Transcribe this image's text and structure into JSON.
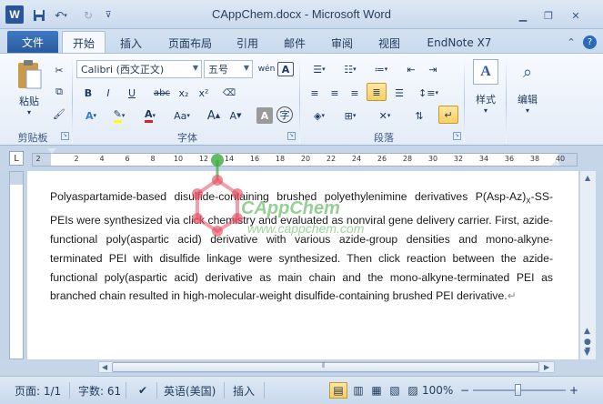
{
  "titlebar": {
    "app_logo": "W",
    "title": "CAppChem.docx - Microsoft Word",
    "save_icon": "save-icon",
    "undo_icon": "undo-icon",
    "redo_icon": "redo-icon",
    "customize_icon": "qat-dropdown-icon"
  },
  "tabs": {
    "file": "文件",
    "items": [
      "开始",
      "插入",
      "页面布局",
      "引用",
      "邮件",
      "审阅",
      "视图",
      "EndNote X7"
    ],
    "active": "开始"
  },
  "ribbon": {
    "clipboard": {
      "label": "剪贴板",
      "paste": "粘贴"
    },
    "font": {
      "label": "字体",
      "font_name": "Calibri (西文正文)",
      "font_size": "五号",
      "bold": "B",
      "italic": "I",
      "underline": "U",
      "strike": "abc",
      "subscript": "x₂",
      "superscript": "x²",
      "grow": "A",
      "shrink": "A",
      "case": "Aa",
      "char_border": "A",
      "char_shade": "A",
      "phonetic": "wén",
      "enclose": "字"
    },
    "paragraph": {
      "label": "段落"
    },
    "styles": {
      "label": "样式"
    },
    "editing": {
      "label": "编辑"
    }
  },
  "ruler": {
    "labels": [
      "2",
      "2",
      "4",
      "6",
      "8",
      "10",
      "12",
      "14",
      "16",
      "18",
      "20",
      "22",
      "24",
      "26",
      "28",
      "30",
      "32",
      "34",
      "36",
      "38",
      "40"
    ],
    "corner": "L"
  },
  "document": {
    "line1": "Polyaspartamide-based disulfide-containing brushed polyethylenimine derivatives",
    "line2a": "P(Asp-Az)",
    "line2sub": "X",
    "line2b": "-SS-PEIs were synthesized via click chemistry and evaluated as nonviral gene delivery carrier. First, azide-functional poly(aspartic acid) derivative with various azide-group densities and mono-alkyne-terminated PEI with disulfide linkage were synthesized. Then click reaction between the azide-functional poly(aspartic acid) derivative as main chain and the mono-alkyne-terminated PEI as branched chain resulted in high-molecular-weight disulfide-containing brushed PEI derivative.",
    "para_mark": "↵",
    "watermark": "CAppChem",
    "watermark_url": "www.cappchem.com"
  },
  "statusbar": {
    "page": "页面: 1/1",
    "words": "字数: 61",
    "language": "英语(美国)",
    "insert_mode": "插入",
    "zoom": "100%",
    "zoom_minus": "−",
    "zoom_plus": "+"
  },
  "colors": {
    "accent": "#2a5aa0",
    "highlight_active": "#f8cf62",
    "watermark": "#3caa3c"
  }
}
